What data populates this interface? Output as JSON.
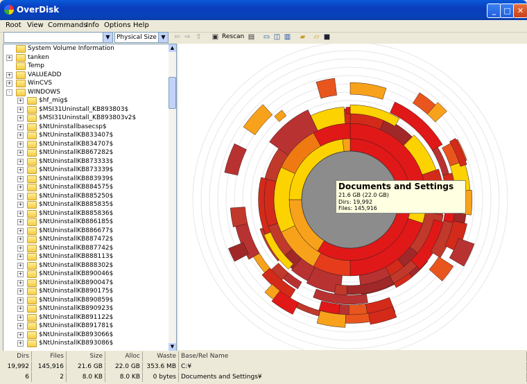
{
  "window": {
    "title": "OverDisk"
  },
  "menu": [
    "Root",
    "View",
    "Commands",
    "Info",
    "Options",
    "Help"
  ],
  "toolbar": {
    "path_value": "",
    "size_mode": "Physical Size",
    "rescan_label": "Rescan"
  },
  "tree": [
    {
      "label": "System Volume Information",
      "depth": 0,
      "expander": "none"
    },
    {
      "label": "tanken",
      "depth": 0,
      "expander": "+"
    },
    {
      "label": "Temp",
      "depth": 0,
      "expander": "none"
    },
    {
      "label": "VALUEADD",
      "depth": 0,
      "expander": "+"
    },
    {
      "label": "WinCVS",
      "depth": 0,
      "expander": "+"
    },
    {
      "label": "WINDOWS",
      "depth": 0,
      "expander": "-"
    },
    {
      "label": "$hf_mig$",
      "depth": 1,
      "expander": "+"
    },
    {
      "label": "$MSI31Uninstall_KB893803$",
      "depth": 1,
      "expander": "+"
    },
    {
      "label": "$MSI31Uninstall_KB893803v2$",
      "depth": 1,
      "expander": "+"
    },
    {
      "label": "$NtUninstallbasecsp$",
      "depth": 1,
      "expander": "+"
    },
    {
      "label": "$NtUninstallKB833407$",
      "depth": 1,
      "expander": "+"
    },
    {
      "label": "$NtUninstallKB834707$",
      "depth": 1,
      "expander": "+"
    },
    {
      "label": "$NtUninstallKB867282$",
      "depth": 1,
      "expander": "+"
    },
    {
      "label": "$NtUninstallKB873333$",
      "depth": 1,
      "expander": "+"
    },
    {
      "label": "$NtUninstallKB873339$",
      "depth": 1,
      "expander": "+"
    },
    {
      "label": "$NtUninstallKB883939$",
      "depth": 1,
      "expander": "+"
    },
    {
      "label": "$NtUninstallKB884575$",
      "depth": 1,
      "expander": "+"
    },
    {
      "label": "$NtUninstallKB885250$",
      "depth": 1,
      "expander": "+"
    },
    {
      "label": "$NtUninstallKB885835$",
      "depth": 1,
      "expander": "+"
    },
    {
      "label": "$NtUninstallKB885836$",
      "depth": 1,
      "expander": "+"
    },
    {
      "label": "$NtUninstallKB886185$",
      "depth": 1,
      "expander": "+"
    },
    {
      "label": "$NtUninstallKB886677$",
      "depth": 1,
      "expander": "+"
    },
    {
      "label": "$NtUninstallKB887472$",
      "depth": 1,
      "expander": "+"
    },
    {
      "label": "$NtUninstallKB887742$",
      "depth": 1,
      "expander": "+"
    },
    {
      "label": "$NtUninstallKB888113$",
      "depth": 1,
      "expander": "+"
    },
    {
      "label": "$NtUninstallKB888302$",
      "depth": 1,
      "expander": "+"
    },
    {
      "label": "$NtUninstallKB890046$",
      "depth": 1,
      "expander": "+"
    },
    {
      "label": "$NtUninstallKB890047$",
      "depth": 1,
      "expander": "+"
    },
    {
      "label": "$NtUninstallKB890175$",
      "depth": 1,
      "expander": "+"
    },
    {
      "label": "$NtUninstallKB890859$",
      "depth": 1,
      "expander": "+"
    },
    {
      "label": "$NtUninstallKB890923$",
      "depth": 1,
      "expander": "+"
    },
    {
      "label": "$NtUninstallKB891122$",
      "depth": 1,
      "expander": "+"
    },
    {
      "label": "$NtUninstallKB891781$",
      "depth": 1,
      "expander": "+"
    },
    {
      "label": "$NtUninstallKB893066$",
      "depth": 1,
      "expander": "+"
    },
    {
      "label": "$NtUninstallKB893086$",
      "depth": 1,
      "expander": "+"
    }
  ],
  "tooltip": {
    "title": "Documents and Settings",
    "size": "21.6 GB (22.0 GB)",
    "dirs": "Dirs: 19,992",
    "files": "Files: 145,916"
  },
  "status": {
    "headers": [
      "Dirs",
      "Files",
      "Size",
      "Alloc",
      "Waste",
      "Base/Rel Name"
    ],
    "rows": [
      [
        "19,992",
        "145,916",
        "21.6 GB",
        "22.0 GB",
        "353.6 MB",
        "C:¥"
      ],
      [
        "6",
        "2",
        "8.0 KB",
        "8.0 KB",
        "0 bytes",
        "Documents and Settings¥"
      ]
    ]
  },
  "colors": {
    "center": "#8c8c8c",
    "ring_red": "#e01818",
    "ring_orange": "#f7a21a",
    "ring_yellow": "#fcd200",
    "dark_red": "#b83232"
  }
}
